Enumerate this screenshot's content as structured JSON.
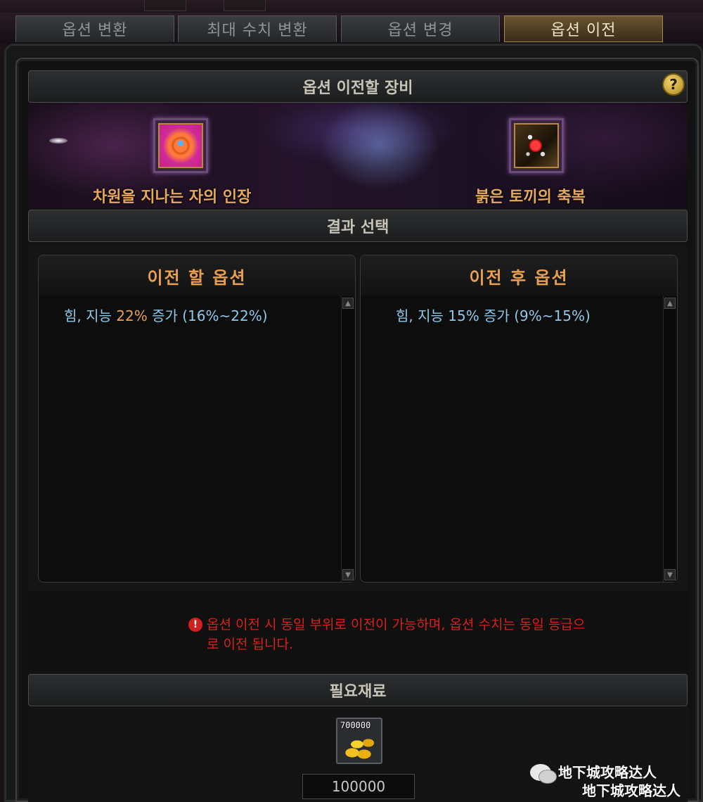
{
  "tabs": [
    {
      "label": "옵션 변환",
      "active": false
    },
    {
      "label": "최대 수치 변환",
      "active": false
    },
    {
      "label": "옵션 변경",
      "active": false
    },
    {
      "label": "옵션 이전",
      "active": true
    }
  ],
  "equip_section": {
    "title": "옵션 이전할 장비",
    "help_label": "?",
    "source_item": {
      "name": "차원을 지나는 자의 인장",
      "icon": "ring-icon"
    },
    "target_item": {
      "name": "붉은 토끼의 축복",
      "icon": "rabbit-icon"
    }
  },
  "result_section": {
    "title": "결과 선택",
    "before_panel": {
      "title": "이전 할 옵션",
      "line_prefix": "힘, 지능 ",
      "line_value": "22%",
      "line_suffix": " 증가 (16%~22%)"
    },
    "after_panel": {
      "title": "이전 후 옵션",
      "line": "힘, 지능 15% 증가 (9%~15%)"
    }
  },
  "warning": {
    "icon": "!",
    "text": "옵션 이전 시 동일 부위로 이전이 가능하며, 옵션 수치는 동일 등급으로 이전 됩니다."
  },
  "materials": {
    "title": "필요재료",
    "item_count": "700000",
    "item_icon": "gold-coins-icon",
    "amount": "100000"
  },
  "watermark": {
    "line1": "地下城攻略达人",
    "line2": "地下城攻略达人"
  },
  "colors": {
    "option_text": "#8fc8e6",
    "highlight": "#e8a050",
    "warning": "#d8201c",
    "active_tab": "#a88a50"
  }
}
